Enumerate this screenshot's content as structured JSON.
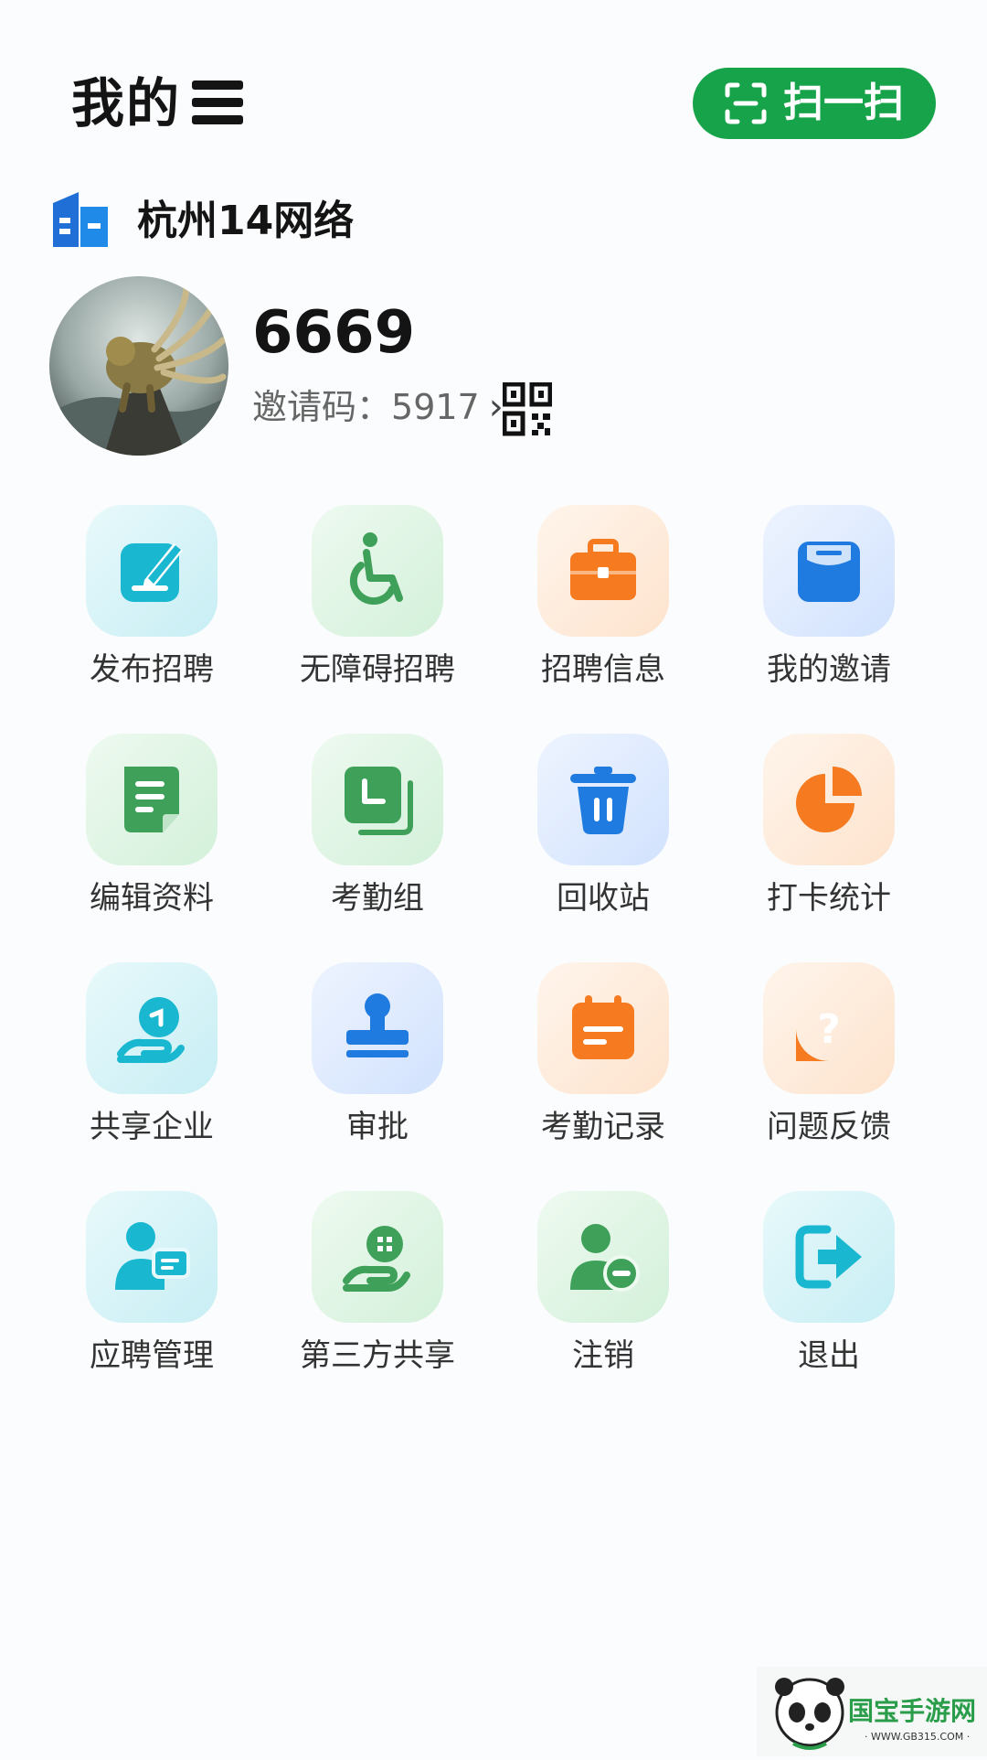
{
  "header": {
    "title": "我的",
    "scan_label": "扫一扫"
  },
  "company": {
    "name": "杭州14网络"
  },
  "profile": {
    "user_id": "6669",
    "invite_label": "邀请码：",
    "invite_code": "5917"
  },
  "menu": [
    {
      "label": "发布招聘",
      "icon": "edit-post-icon",
      "color": "#1ab8d0"
    },
    {
      "label": "无障碍招聘",
      "icon": "wheelchair-icon",
      "color": "#3fa05a"
    },
    {
      "label": "招聘信息",
      "icon": "briefcase-icon",
      "color": "#f57a20"
    },
    {
      "label": "我的邀请",
      "icon": "inbox-icon",
      "color": "#1f7be0"
    },
    {
      "label": "编辑资料",
      "icon": "document-icon",
      "color": "#3fa05a"
    },
    {
      "label": "考勤组",
      "icon": "clock-stack-icon",
      "color": "#3fa05a"
    },
    {
      "label": "回收站",
      "icon": "trash-icon",
      "color": "#1f7be0"
    },
    {
      "label": "打卡统计",
      "icon": "pie-chart-icon",
      "color": "#f57a20"
    },
    {
      "label": "共享企业",
      "icon": "hand-person-icon",
      "color": "#1ab8d0"
    },
    {
      "label": "审批",
      "icon": "stamp-icon",
      "color": "#1f7be0"
    },
    {
      "label": "考勤记录",
      "icon": "calendar-icon",
      "color": "#f57a20"
    },
    {
      "label": "问题反馈",
      "icon": "question-icon",
      "color": "#f57a20"
    },
    {
      "label": "应聘管理",
      "icon": "person-chat-icon",
      "color": "#1ab8d0"
    },
    {
      "label": "第三方共享",
      "icon": "hand-share-icon",
      "color": "#3fa05a"
    },
    {
      "label": "注销",
      "icon": "person-remove-icon",
      "color": "#3fa05a"
    },
    {
      "label": "退出",
      "icon": "logout-icon",
      "color": "#1ab8d0"
    }
  ],
  "watermark": {
    "brand": "国宝手游网",
    "url": "WWW.GB315.COM"
  }
}
